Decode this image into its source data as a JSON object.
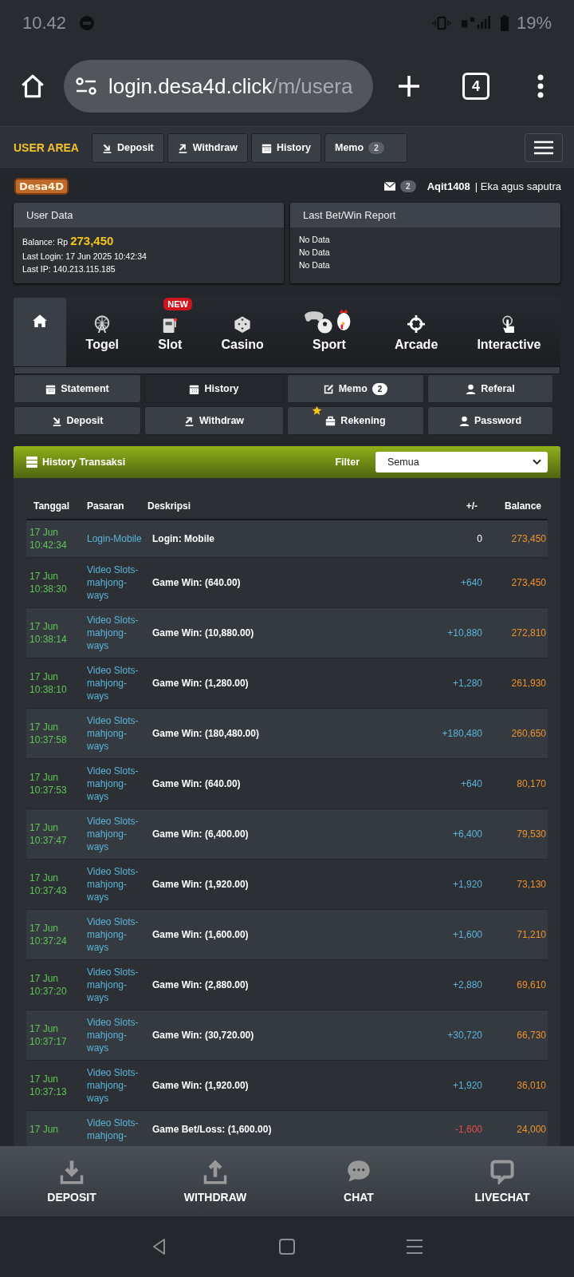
{
  "status_bar": {
    "time": "10.42",
    "battery": "19%"
  },
  "browser": {
    "url_host": "login.desa4d.click",
    "url_path": "/m/usera",
    "tab_count": "4"
  },
  "user_area": {
    "title": "USER AREA",
    "buttons": [
      {
        "label": "Deposit"
      },
      {
        "label": "Withdraw"
      },
      {
        "label": "History"
      },
      {
        "label": "Memo",
        "badge": "2"
      }
    ]
  },
  "header": {
    "logo": "Desa4D",
    "mail_count": "2",
    "username": "Aqit1408",
    "fullname": "| Eka agus saputra"
  },
  "user_data": {
    "title": "User Data",
    "balance_label": "Balance: Rp",
    "balance": "273,450",
    "last_login": "Last Login: 17 Jun 2025 10:42:34",
    "last_ip": "Last IP: 140.213.115.185"
  },
  "report": {
    "title": "Last Bet/Win Report",
    "lines": [
      "No Data",
      "No Data",
      "No Data"
    ]
  },
  "game_tabs": [
    {
      "selected": true
    },
    {
      "label": "Togel",
      "selected": false
    },
    {
      "label": "Slot",
      "badge": "NEW",
      "selected": false
    },
    {
      "label": "Casino",
      "selected": false
    },
    {
      "label": "Sport",
      "selected": false
    },
    {
      "label": "Arcade",
      "selected": false
    },
    {
      "label": "Interactive",
      "selected": false
    }
  ],
  "menu_buttons": [
    {
      "label": "Statement",
      "selected": false
    },
    {
      "label": "History",
      "selected": true
    },
    {
      "label": "Memo",
      "badge": "2",
      "selected": false
    },
    {
      "label": "Referal",
      "selected": false
    },
    {
      "label": "Deposit",
      "selected": false
    },
    {
      "label": "Withdraw",
      "selected": false
    },
    {
      "label": "Rekening",
      "star": true,
      "selected": false
    },
    {
      "label": "Password",
      "selected": false
    }
  ],
  "history": {
    "title": "History Transaksi",
    "filter_label": "Filter",
    "filter_value": "Semua",
    "columns": [
      "Tanggal",
      "Pasaran",
      "Deskripsi",
      "+/-",
      "Balance"
    ],
    "rows": [
      {
        "date": "17 Jun 10:42:34",
        "pasaran": "Login-Mobile",
        "description": "Login: Mobile",
        "amount": "0",
        "kind": "neutral",
        "balance": "273,450"
      },
      {
        "date": "17 Jun 10:38:30",
        "pasaran": "Video Slots-mahjong-ways",
        "description": "Game Win: (640.00)",
        "amount": "+640",
        "kind": "win",
        "balance": "273,450"
      },
      {
        "date": "17 Jun 10:38:14",
        "pasaran": "Video Slots-mahjong-ways",
        "description": "Game Win: (10,880.00)",
        "amount": "+10,880",
        "kind": "win",
        "balance": "272,810"
      },
      {
        "date": "17 Jun 10:38:10",
        "pasaran": "Video Slots-mahjong-ways",
        "description": "Game Win: (1,280.00)",
        "amount": "+1,280",
        "kind": "win",
        "balance": "261,930"
      },
      {
        "date": "17 Jun 10:37:58",
        "pasaran": "Video Slots-mahjong-ways",
        "description": "Game Win: (180,480.00)",
        "amount": "+180,480",
        "kind": "win",
        "balance": "260,650"
      },
      {
        "date": "17 Jun 10:37:53",
        "pasaran": "Video Slots-mahjong-ways",
        "description": "Game Win: (640.00)",
        "amount": "+640",
        "kind": "win",
        "balance": "80,170"
      },
      {
        "date": "17 Jun 10:37:47",
        "pasaran": "Video Slots-mahjong-ways",
        "description": "Game Win: (6,400.00)",
        "amount": "+6,400",
        "kind": "win",
        "balance": "79,530"
      },
      {
        "date": "17 Jun 10:37:43",
        "pasaran": "Video Slots-mahjong-ways",
        "description": "Game Win: (1,920.00)",
        "amount": "+1,920",
        "kind": "win",
        "balance": "73,130"
      },
      {
        "date": "17 Jun 10:37:24",
        "pasaran": "Video Slots-mahjong-ways",
        "description": "Game Win: (1,600.00)",
        "amount": "+1,600",
        "kind": "win",
        "balance": "71,210"
      },
      {
        "date": "17 Jun 10:37:20",
        "pasaran": "Video Slots-mahjong-ways",
        "description": "Game Win: (2,880.00)",
        "amount": "+2,880",
        "kind": "win",
        "balance": "69,610"
      },
      {
        "date": "17 Jun 10:37:17",
        "pasaran": "Video Slots-mahjong-ways",
        "description": "Game Win: (30,720.00)",
        "amount": "+30,720",
        "kind": "win",
        "balance": "66,730"
      },
      {
        "date": "17 Jun 10:37:13",
        "pasaran": "Video Slots-mahjong-ways",
        "description": "Game Win: (1,920.00)",
        "amount": "+1,920",
        "kind": "win",
        "balance": "36,010"
      },
      {
        "date": "17 Jun",
        "pasaran": "Video Slots-mahjong-",
        "description": "Game Bet/Loss: (1,600.00)",
        "amount": "-1,600",
        "kind": "loss",
        "balance": "24,000"
      }
    ]
  },
  "bottom_nav": [
    {
      "label": "DEPOSIT"
    },
    {
      "label": "WITHDRAW"
    },
    {
      "label": "CHAT"
    },
    {
      "label": "LIVECHAT"
    }
  ]
}
